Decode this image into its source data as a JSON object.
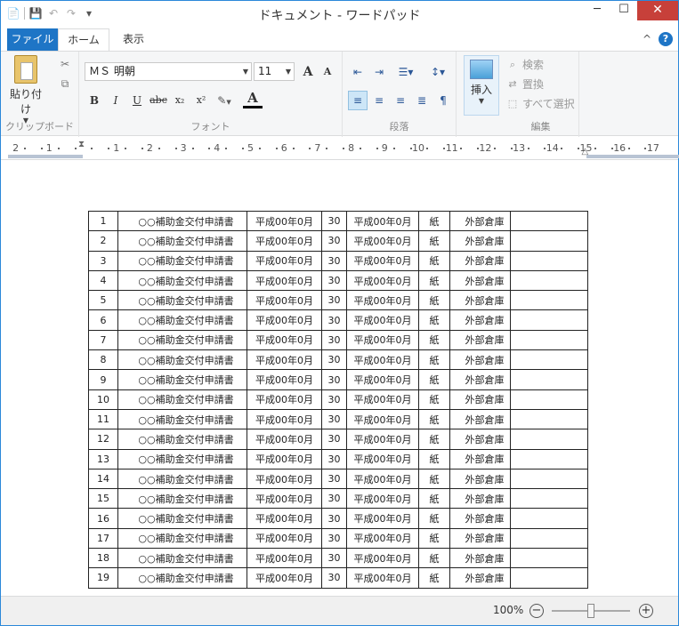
{
  "window": {
    "title": "ドキュメント - ワードパッド",
    "minimize": "─",
    "maximize": "☐",
    "close": "✕"
  },
  "qat": {
    "app_icon": "📄",
    "save": "💾",
    "undo": "↶",
    "redo": "↷",
    "more": "▾"
  },
  "tabs": {
    "file": "ファイル",
    "home": "ホーム",
    "view": "表示",
    "collapse": "^",
    "help": "?"
  },
  "ribbon": {
    "clipboard": {
      "paste": "貼り付け",
      "cut_icon": "✂",
      "copy_icon": "⧉",
      "group": "クリップボード"
    },
    "font": {
      "name": "ＭＳ 明朝",
      "size": "11",
      "grow": "A",
      "shrink": "A",
      "bold": "B",
      "italic": "I",
      "underline": "U",
      "strike": "abc",
      "subscript": "x₂",
      "superscript": "x²",
      "highlight": "✎",
      "color": "A",
      "group": "フォント"
    },
    "paragraph": {
      "group": "段落"
    },
    "insert": {
      "label": "挿入"
    },
    "editing": {
      "find": "検索",
      "replace": "置換",
      "select_all": "すべて選択",
      "group": "編集"
    }
  },
  "ruler": {
    "ticks": [
      "2",
      "1",
      "1",
      "2",
      "3",
      "4",
      "5",
      "6",
      "7",
      "8",
      "9",
      "10",
      "11",
      "12",
      "13",
      "14",
      "15",
      "16",
      "17"
    ]
  },
  "table": {
    "rows": [
      [
        "1",
        "○○補助金交付申請書",
        "平成00年0月",
        "30",
        "平成00年0月",
        "紙",
        "外部倉庫",
        ""
      ],
      [
        "2",
        "○○補助金交付申請書",
        "平成00年0月",
        "30",
        "平成00年0月",
        "紙",
        "外部倉庫",
        ""
      ],
      [
        "3",
        "○○補助金交付申請書",
        "平成00年0月",
        "30",
        "平成00年0月",
        "紙",
        "外部倉庫",
        ""
      ],
      [
        "4",
        "○○補助金交付申請書",
        "平成00年0月",
        "30",
        "平成00年0月",
        "紙",
        "外部倉庫",
        ""
      ],
      [
        "5",
        "○○補助金交付申請書",
        "平成00年0月",
        "30",
        "平成00年0月",
        "紙",
        "外部倉庫",
        ""
      ],
      [
        "6",
        "○○補助金交付申請書",
        "平成00年0月",
        "30",
        "平成00年0月",
        "紙",
        "外部倉庫",
        ""
      ],
      [
        "7",
        "○○補助金交付申請書",
        "平成00年0月",
        "30",
        "平成00年0月",
        "紙",
        "外部倉庫",
        ""
      ],
      [
        "8",
        "○○補助金交付申請書",
        "平成00年0月",
        "30",
        "平成00年0月",
        "紙",
        "外部倉庫",
        ""
      ],
      [
        "9",
        "○○補助金交付申請書",
        "平成00年0月",
        "30",
        "平成00年0月",
        "紙",
        "外部倉庫",
        ""
      ],
      [
        "10",
        "○○補助金交付申請書",
        "平成00年0月",
        "30",
        "平成00年0月",
        "紙",
        "外部倉庫",
        ""
      ],
      [
        "11",
        "○○補助金交付申請書",
        "平成00年0月",
        "30",
        "平成00年0月",
        "紙",
        "外部倉庫",
        ""
      ],
      [
        "12",
        "○○補助金交付申請書",
        "平成00年0月",
        "30",
        "平成00年0月",
        "紙",
        "外部倉庫",
        ""
      ],
      [
        "13",
        "○○補助金交付申請書",
        "平成00年0月",
        "30",
        "平成00年0月",
        "紙",
        "外部倉庫",
        ""
      ],
      [
        "14",
        "○○補助金交付申請書",
        "平成00年0月",
        "30",
        "平成00年0月",
        "紙",
        "外部倉庫",
        ""
      ],
      [
        "15",
        "○○補助金交付申請書",
        "平成00年0月",
        "30",
        "平成00年0月",
        "紙",
        "外部倉庫",
        ""
      ],
      [
        "16",
        "○○補助金交付申請書",
        "平成00年0月",
        "30",
        "平成00年0月",
        "紙",
        "外部倉庫",
        ""
      ],
      [
        "17",
        "○○補助金交付申請書",
        "平成00年0月",
        "30",
        "平成00年0月",
        "紙",
        "外部倉庫",
        ""
      ],
      [
        "18",
        "○○補助金交付申請書",
        "平成00年0月",
        "30",
        "平成00年0月",
        "紙",
        "外部倉庫",
        ""
      ],
      [
        "19",
        "○○補助金交付申請書",
        "平成00年0月",
        "30",
        "平成00年0月",
        "紙",
        "外部倉庫",
        ""
      ]
    ]
  },
  "status": {
    "zoom": "100%",
    "zoom_out": "−",
    "zoom_in": "+",
    "zoom_level": 0.5
  }
}
